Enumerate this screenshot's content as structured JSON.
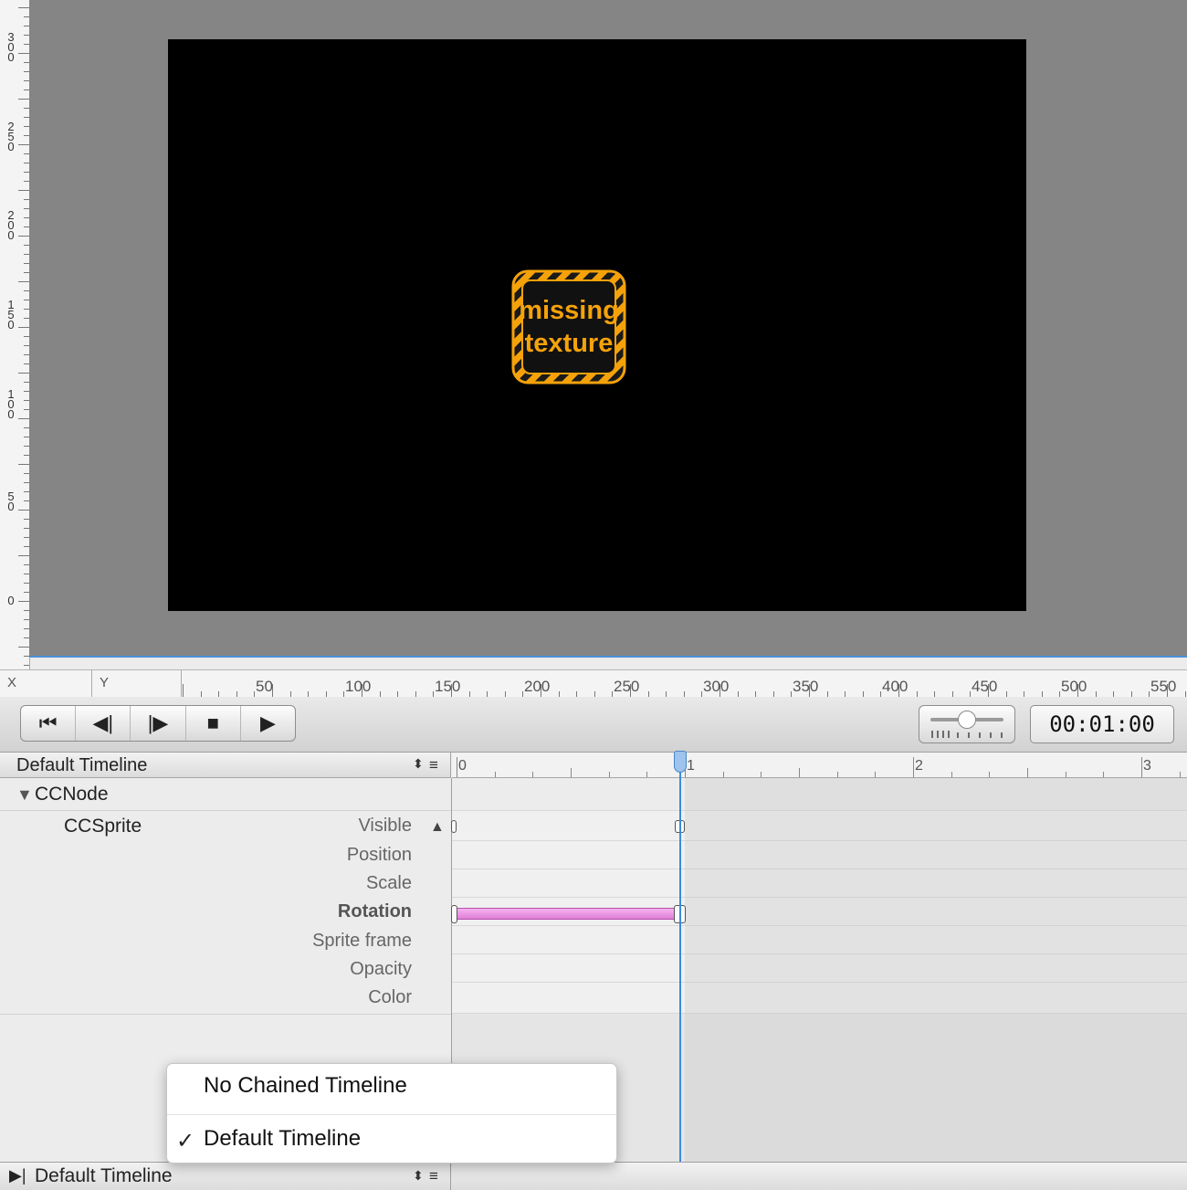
{
  "rulers": {
    "vertical_labels": [
      "300",
      "250",
      "200",
      "150",
      "100",
      "50",
      "0"
    ],
    "x_field": "X",
    "y_field": "Y",
    "horizontal_labels": [
      "50",
      "100",
      "150",
      "200",
      "250",
      "300",
      "350",
      "400",
      "450",
      "500",
      "550"
    ]
  },
  "stage": {
    "sprite_text_line1": "missing",
    "sprite_text_line2": "texture",
    "sprite_color": "#f5a20a",
    "background_color": "#000000",
    "canvas_color": "#858585"
  },
  "transport": {
    "buttons": [
      "go-to-start",
      "step-back",
      "step-forward",
      "stop",
      "play"
    ],
    "glyphs": [
      "⏮",
      "◀︎|",
      "|▶︎",
      "■",
      "▶"
    ],
    "timecode": "00:01:00"
  },
  "timeline": {
    "current_name": "Default Timeline",
    "ruler_labels": [
      "0",
      "1",
      "2",
      "3"
    ],
    "playhead_seconds": 1,
    "node": "CCNode",
    "sprite": "CCSprite",
    "properties": [
      "Visible",
      "Position",
      "Scale",
      "Rotation",
      "Sprite frame",
      "Opacity",
      "Color"
    ],
    "keyframes": {
      "Visible": [
        0,
        1
      ],
      "Rotation": [
        0,
        1
      ]
    },
    "rotation_color": "#e98fe0"
  },
  "chain_menu": {
    "items": [
      "No Chained Timeline",
      "Default Timeline"
    ],
    "checked_index": 1,
    "check_mark": "✓"
  },
  "bottom_bar": {
    "chained_timeline": "Default Timeline"
  }
}
